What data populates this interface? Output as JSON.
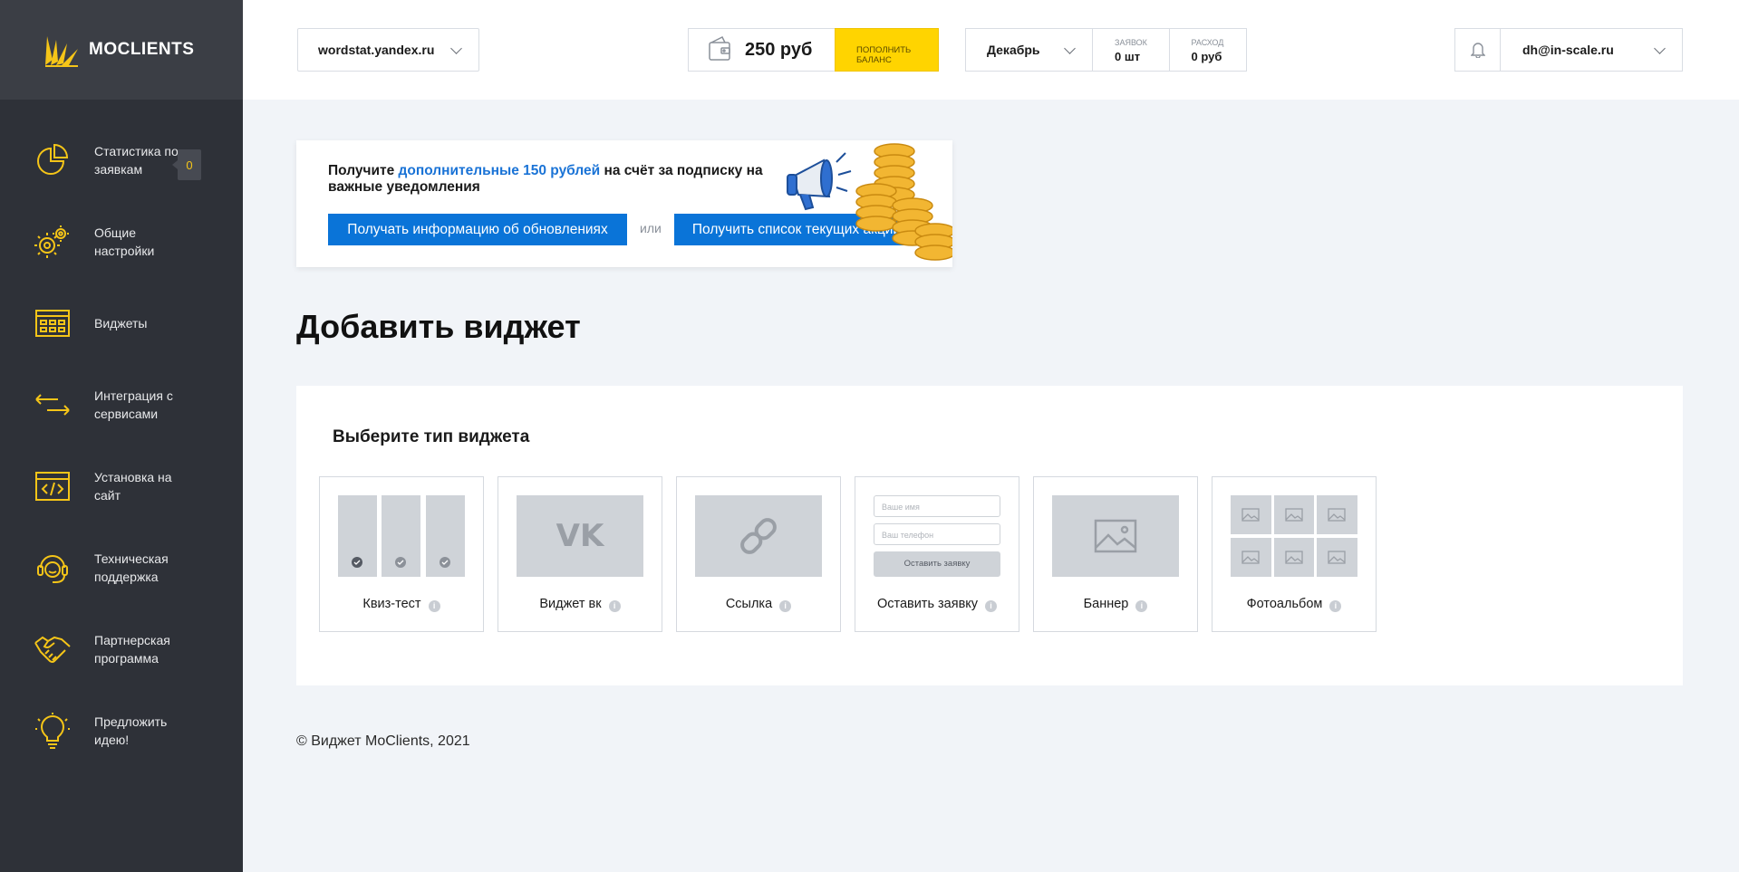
{
  "app": {
    "logo_text": "MOCLIENTS"
  },
  "sidebar": {
    "items": [
      {
        "label": "Статистика по заявкам",
        "badge": "0",
        "icon": "pie-chart-icon"
      },
      {
        "label": "Общие настройки",
        "icon": "gears-icon"
      },
      {
        "label": "Виджеты",
        "icon": "widget-grid-icon"
      },
      {
        "label": "Интеграция с сервисами",
        "icon": "arrows-exchange-icon"
      },
      {
        "label": "Установка на сайт",
        "icon": "code-window-icon"
      },
      {
        "label": "Техническая поддержка",
        "icon": "headset-icon"
      },
      {
        "label": "Партнерская программа",
        "icon": "handshake-icon"
      },
      {
        "label": "Предложить идею!",
        "icon": "lightbulb-icon"
      }
    ]
  },
  "header": {
    "site": "wordstat.yandex.ru",
    "balance": "250 руб",
    "topup_label": "ПОПОЛНИТЬ БАЛАНС",
    "month": "Декабрь",
    "requests_label": "ЗАЯВОК",
    "requests_value": "0 шт",
    "expense_label": "РАСХОД",
    "expense_value": "0 руб",
    "user_email": "dh@in-scale.ru"
  },
  "promo": {
    "text_before": "Получите ",
    "text_highlight": "дополнительные 150 рублей",
    "text_after": " на счёт за подписку на важные уведомления",
    "button_updates": "Получать информацию об обновлениях",
    "or_label": "или",
    "button_promos": "Получить список текущих акций"
  },
  "page": {
    "title": "Добавить виджет",
    "subtitle": "Выберите тип виджета",
    "footer": "© Виджет MoClients, 2021"
  },
  "widgets": [
    {
      "label": "Квиз-тест"
    },
    {
      "label": "Виджет вк"
    },
    {
      "label": "Ссылка"
    },
    {
      "label": "Оставить заявку",
      "name_placeholder": "Ваше имя",
      "phone_placeholder": "Ваш телефон",
      "button": "Оставить заявку"
    },
    {
      "label": "Баннер"
    },
    {
      "label": "Фотоальбом"
    }
  ],
  "colors": {
    "accent_yellow": "#ffd400",
    "primary_blue": "#0a74d8",
    "sidebar_bg": "#2e3138",
    "highlight_blue": "#1a73d6"
  }
}
